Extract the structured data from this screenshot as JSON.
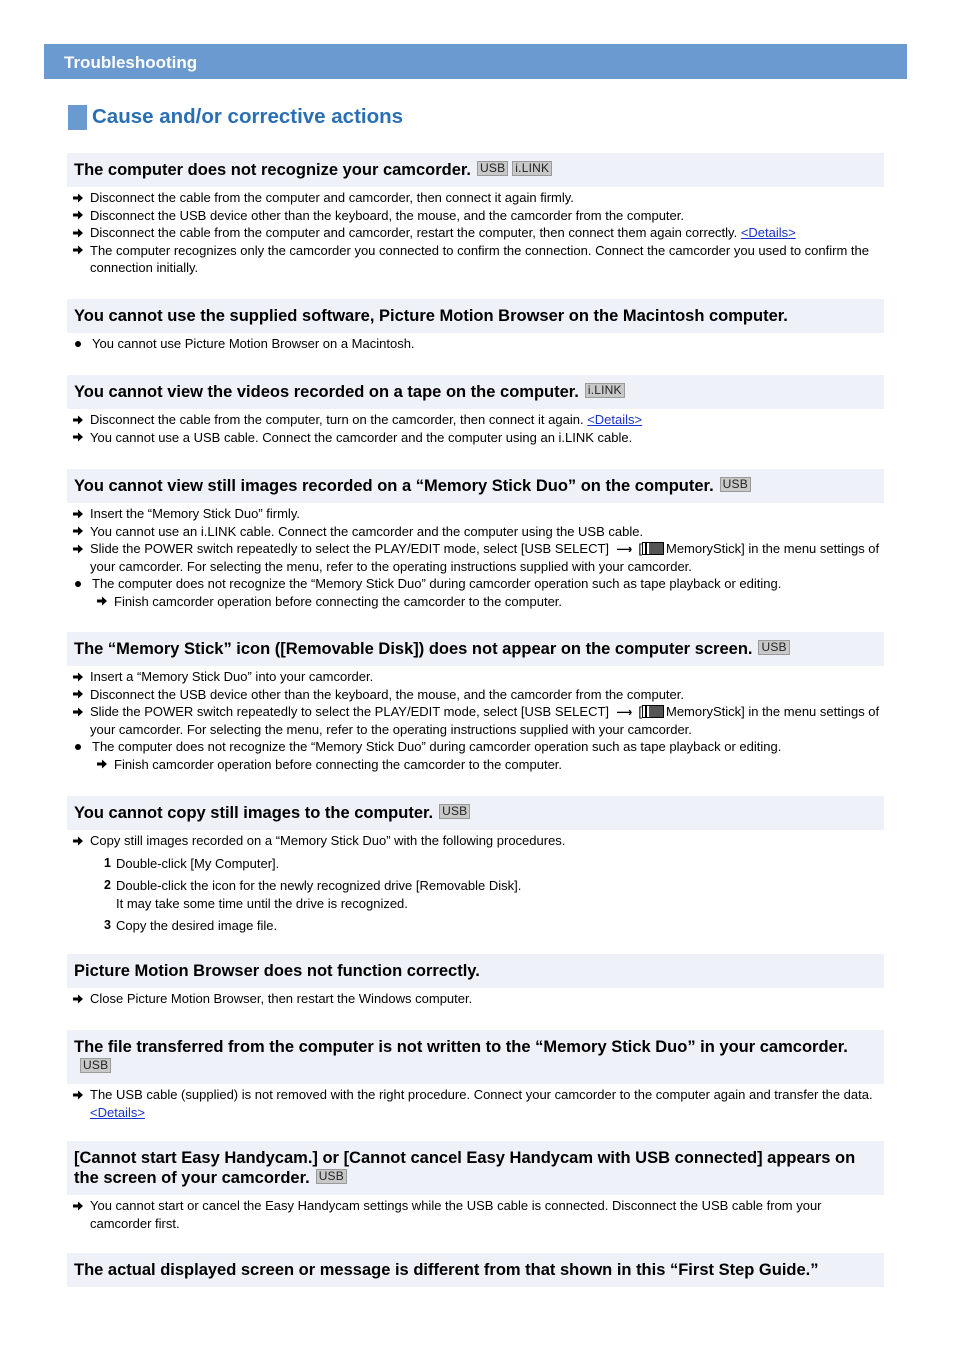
{
  "header": {
    "title": "Troubleshooting"
  },
  "page": {
    "heading": "Cause and/or corrective actions"
  },
  "sections": [
    {
      "title": "The computer does not recognize your camcorder.",
      "badges": [
        "USB",
        "i.LINK"
      ],
      "items": [
        {
          "type": "arrow",
          "text": "Disconnect the cable from the computer and camcorder, then connect it again firmly."
        },
        {
          "type": "arrow",
          "text": "Disconnect the USB device other than the keyboard, the mouse, and the camcorder from the computer."
        },
        {
          "type": "arrow",
          "text": "Disconnect the cable from the computer and camcorder, restart the computer, then connect them again correctly.",
          "link": "<Details>"
        },
        {
          "type": "arrow",
          "text": "The computer recognizes only the camcorder you connected to confirm the connection. Connect the camcorder you used to confirm the connection initially."
        }
      ]
    },
    {
      "title": "You cannot use the supplied software, Picture Motion Browser on the Macintosh computer.",
      "badges": [],
      "items": [
        {
          "type": "bullet",
          "text": "You cannot use Picture Motion Browser on a Macintosh."
        }
      ]
    },
    {
      "title": "You cannot view the videos recorded on a tape on the computer.",
      "badges": [
        "i.LINK"
      ],
      "items": [
        {
          "type": "arrow",
          "text": "Disconnect the cable from the computer, turn on the camcorder, then connect it again.",
          "link": "<Details>"
        },
        {
          "type": "arrow",
          "text": "You cannot use a USB cable. Connect the camcorder and the computer using an i.LINK cable."
        }
      ]
    },
    {
      "title": "You cannot view still images recorded on a “Memory Stick Duo” on the computer.",
      "badges": [
        "USB"
      ],
      "items": [
        {
          "type": "arrow",
          "text": "Insert the “Memory Stick Duo” firmly."
        },
        {
          "type": "arrow",
          "text": "You cannot use an i.LINK cable. Connect the camcorder and the computer using the USB cable."
        },
        {
          "type": "arrow-menu",
          "text_before": "Slide the POWER switch repeatedly to select the PLAY/EDIT mode, select [USB SELECT]",
          "text_after": "MemoryStick] in the menu settings of your camcorder. For selecting the menu, refer to the operating instructions supplied with your camcorder."
        },
        {
          "type": "bullet",
          "text": "The computer does not recognize the “Memory Stick Duo” during camcorder operation such as tape playback or editing."
        },
        {
          "type": "sub",
          "text": "Finish camcorder operation before connecting the camcorder to the computer."
        }
      ]
    },
    {
      "title": "The “Memory Stick” icon ([Removable Disk]) does not appear on the computer screen.",
      "badges": [
        "USB"
      ],
      "items": [
        {
          "type": "arrow",
          "text": "Insert a “Memory Stick Duo” into your camcorder."
        },
        {
          "type": "arrow",
          "text": "Disconnect the USB device other than the keyboard, the mouse, and the camcorder from the computer."
        },
        {
          "type": "arrow-menu",
          "text_before": "Slide the POWER switch repeatedly to select the PLAY/EDIT mode, select [USB SELECT]",
          "text_after": "MemoryStick] in the menu settings of your camcorder. For selecting the menu, refer to the operating instructions supplied with your camcorder."
        },
        {
          "type": "bullet",
          "text": "The computer does not recognize the “Memory Stick Duo” during camcorder operation such as tape playback or editing."
        },
        {
          "type": "sub",
          "text": "Finish camcorder operation before connecting the camcorder to the computer."
        }
      ]
    },
    {
      "title": "You cannot copy still images to the computer.",
      "badges": [
        "USB"
      ],
      "items": [
        {
          "type": "arrow",
          "text": "Copy still images recorded on a “Memory Stick Duo” with the following procedures."
        }
      ],
      "steps": [
        {
          "num": "1",
          "text": "Double-click [My Computer]."
        },
        {
          "num": "2",
          "text": "Double-click the icon for the newly recognized drive [Removable Disk].",
          "text2": "It may take some time until the drive is recognized."
        },
        {
          "num": "3",
          "text": "Copy the desired image file."
        }
      ]
    },
    {
      "title": "Picture Motion Browser does not function correctly.",
      "badges": [],
      "items": [
        {
          "type": "arrow",
          "text": "Close Picture Motion Browser, then restart the Windows computer."
        }
      ]
    },
    {
      "title": "The file transferred from the computer is not written to the “Memory Stick Duo” in your camcorder.",
      "badges": [
        "USB"
      ],
      "items": [
        {
          "type": "arrow",
          "text": "The USB cable (supplied) is not removed with the right procedure. Connect your camcorder to the computer again and transfer the data.",
          "link": "<Details>"
        }
      ]
    },
    {
      "title": "[Cannot start Easy Handycam.] or [Cannot cancel Easy Handycam with USB connected] appears on the screen of your camcorder.",
      "badges": [
        "USB"
      ],
      "items": [
        {
          "type": "arrow",
          "text": "You cannot start or cancel the Easy Handycam settings while the USB cable is connected. Disconnect the USB cable from your camcorder first."
        }
      ]
    },
    {
      "title": "The actual displayed screen or message is different from that shown in this “First Step Guide.”",
      "badges": [],
      "items": []
    }
  ]
}
